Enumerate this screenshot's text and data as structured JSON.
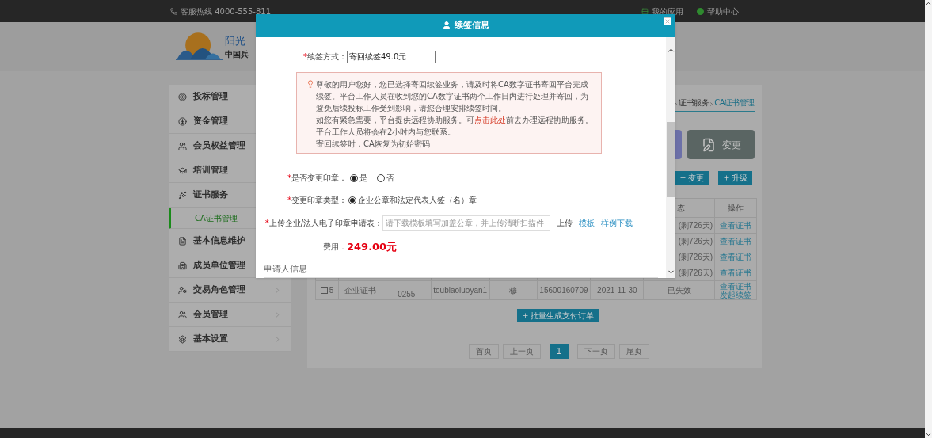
{
  "top_bar": {
    "hotline": "客服热线 4000-555-811",
    "links": [
      "我的应用",
      "帮助中心"
    ]
  },
  "header": {
    "brand": "阳光",
    "brand_sub": "中国兵"
  },
  "sidebar": {
    "items": [
      {
        "label": "投标管理",
        "selected": false
      },
      {
        "label": "资金管理",
        "selected": false
      },
      {
        "label": "会员权益管理",
        "selected": false
      },
      {
        "label": "培训管理",
        "selected": false
      },
      {
        "label": "证书服务",
        "selected": false,
        "children": [
          {
            "label": "CA证书管理",
            "selected": true
          }
        ]
      },
      {
        "label": "基本信息维护",
        "selected": false
      },
      {
        "label": "成员单位管理",
        "selected": false
      },
      {
        "label": "交易角色管理",
        "selected": false,
        "expandable": true
      },
      {
        "label": "会员管理",
        "selected": false,
        "expandable": true
      },
      {
        "label": "基本设置",
        "selected": false,
        "expandable": true
      }
    ]
  },
  "breadcrumb": [
    "证书服务",
    "CA证书管理"
  ],
  "action_card": {
    "label": "变更"
  },
  "toolbar_buttons": [
    "变更",
    "升级"
  ],
  "table": {
    "headers_visible": [
      "态",
      "操作"
    ],
    "rows": [
      {
        "status": "(剩726天)",
        "actions": [
          "查看证书"
        ]
      },
      {
        "status": "(剩726天)",
        "actions": [
          "查看证书"
        ]
      },
      {
        "status": "(剩726天)",
        "actions": [
          "查看证书"
        ]
      },
      {
        "status": "(剩726天)",
        "actions": [
          "查看证书"
        ]
      },
      {
        "checked": false,
        "no": "5",
        "type": "企业证书",
        "number": "0255",
        "account": "toubiaoluoyan1",
        "name": "穆",
        "phone": "15600160709",
        "date": "2021-11-30",
        "status": "已失效",
        "actions": [
          "查看证书",
          "发起续签"
        ]
      }
    ]
  },
  "batch_button": "批量生成支付订单",
  "pagination": [
    {
      "label": "首页",
      "selected": false
    },
    {
      "label": "上一页",
      "selected": false
    },
    {
      "label": "1",
      "selected": true
    },
    {
      "label": "下一页",
      "selected": false
    },
    {
      "label": "尾页",
      "selected": false
    }
  ],
  "modal": {
    "title": "续签信息",
    "renew_method": {
      "mark": "*",
      "label": "续签方式：",
      "value": "寄回续签49.0元"
    },
    "notice": [
      {
        "text": "尊敬的用户您好，您已选择寄回续签业务，请及时将CA数字证书寄回平台完成续签。平台工作人员在收到您的CA数字证书两个工作日内进行处理并寄回，为避免后续投标工作受到影响，请您合理安排续签时间。"
      },
      {
        "before": "如您有紧急需要，平台提供远程协助服务。可",
        "link": "点击此处",
        "after": "前去办理远程协助服务。平台工作人员将会在2小时内与您联系。"
      },
      {
        "text": "寄回续签时，CA恢复为初始密码"
      }
    ],
    "change_seal": {
      "mark": "*",
      "label": "是否变更印章：",
      "options": [
        {
          "label": "是",
          "selected": true
        },
        {
          "label": "否",
          "selected": false
        }
      ]
    },
    "seal_type": {
      "mark": "*",
      "label": "变更印章类型：",
      "options": [
        {
          "label": "企业公章和法定代表人签（名）章",
          "selected": true
        }
      ]
    },
    "upload": {
      "mark": "*",
      "label": "上传企业/法人电子印章申请表：",
      "placeholder": "请下载模板填写加盖公章，并上传清晰扫描件",
      "links": [
        "上传",
        "模板",
        "样例下载"
      ]
    },
    "fee": {
      "label": "费用：",
      "value": "249.00元"
    },
    "section_title": "申请人信息"
  }
}
